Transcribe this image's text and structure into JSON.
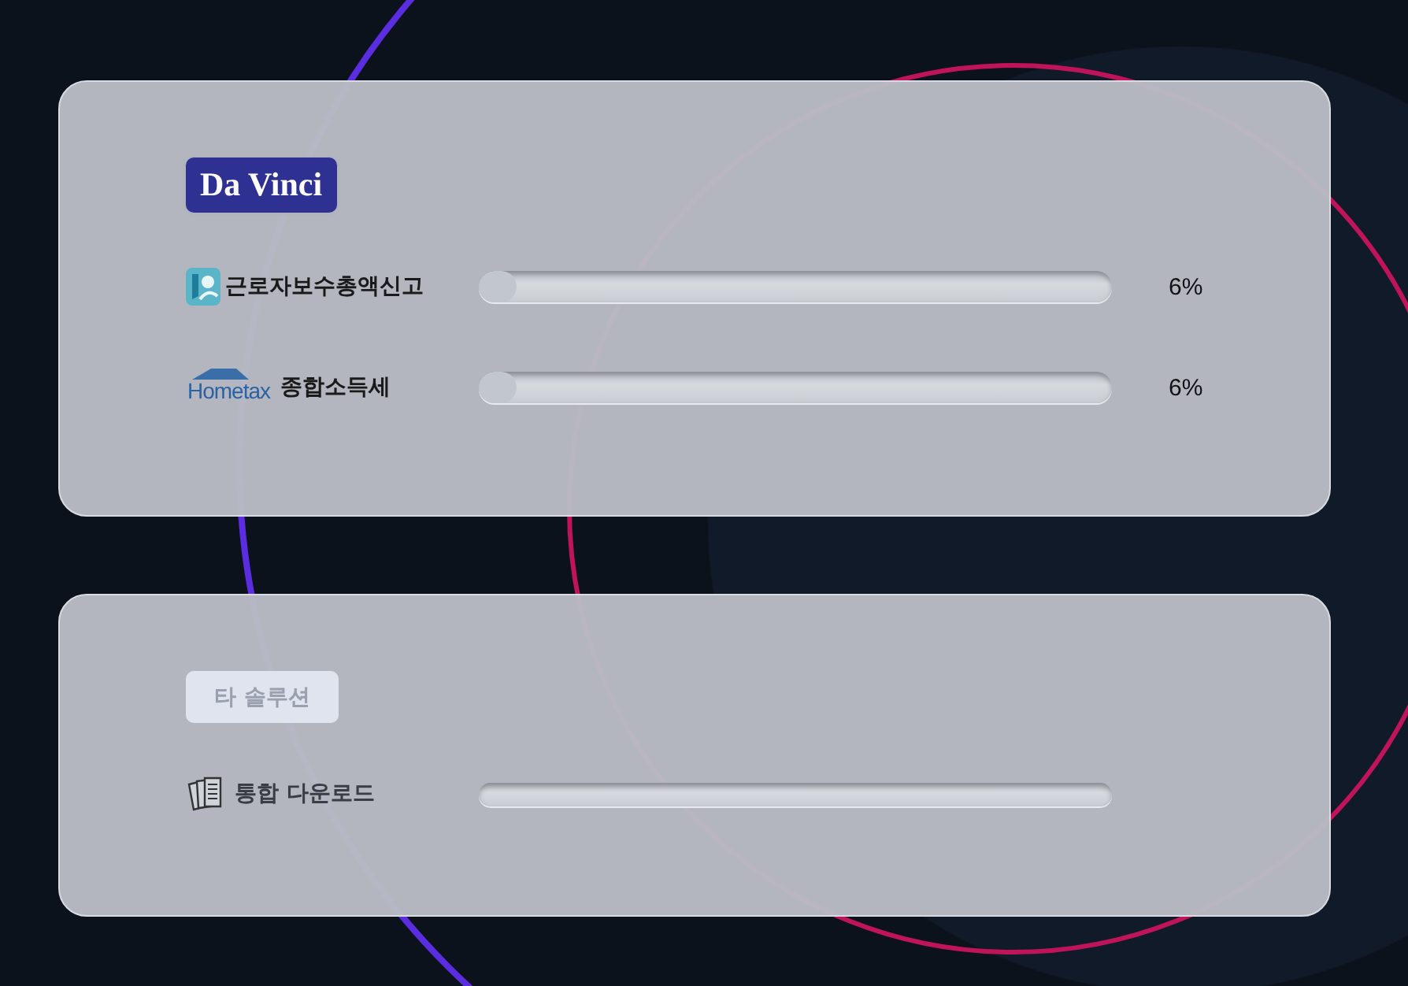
{
  "panels": [
    {
      "badge": {
        "label": "Da Vinci",
        "highlighted": true
      },
      "rows": [
        {
          "kind": "lp",
          "label": "근로자보수총액신고",
          "level": 0.06,
          "reading": "6%"
        },
        {
          "kind": "hometax",
          "logo_text": "Hometax",
          "label": "종합소득세",
          "level": 0.06,
          "reading": "6%"
        }
      ]
    },
    {
      "badge": {
        "label": "타 솔루션",
        "highlighted": false
      },
      "rows": [
        {
          "kind": "docs",
          "label": "통합 다운로드"
        }
      ]
    }
  ]
}
